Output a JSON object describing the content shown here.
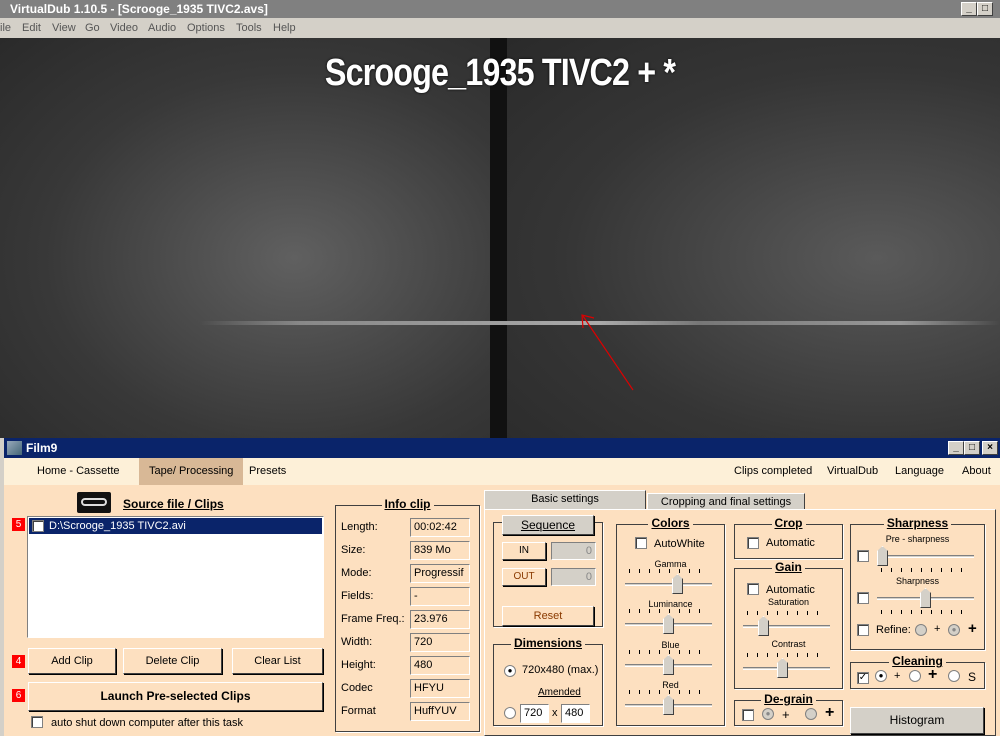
{
  "virtualdub": {
    "title": "VirtualDub 1.10.5 - [Scrooge_1935 TIVC2.avs]",
    "menu": [
      "ile",
      "Edit",
      "View",
      "Go",
      "Video",
      "Audio",
      "Options",
      "Tools",
      "Help"
    ],
    "overlay_text": "Scrooge_1935 TIVC2 +  *"
  },
  "film9": {
    "title": "Film9",
    "menu_left": [
      "Home - Cassette",
      "Tape/ Processing",
      "Presets"
    ],
    "menu_right": [
      "Clips completed",
      "VirtualDub",
      "Language",
      "About"
    ],
    "source": {
      "heading": "Source file / Clips",
      "clips": [
        {
          "name": "D:\\Scrooge_1935 TIVC2.avi",
          "checked": false
        }
      ],
      "badges": [
        "5",
        "4",
        "6"
      ],
      "add": "Add Clip",
      "delete": "Delete Clip",
      "clear": "Clear List",
      "launch": "Launch Pre-selected Clips",
      "shutdown": "auto shut down computer after this task"
    },
    "info": {
      "heading": "Info clip",
      "rows": [
        {
          "label": "Length:",
          "value": "00:02:42"
        },
        {
          "label": "Size:",
          "value": "839 Mo"
        },
        {
          "label": "Mode:",
          "value": "Progressif"
        },
        {
          "label": "Fields:",
          "value": "-"
        },
        {
          "label": "Frame Freq.:",
          "value": "23.976"
        },
        {
          "label": "Width:",
          "value": "720"
        },
        {
          "label": "Height:",
          "value": "480"
        },
        {
          "label": "Codec",
          "value": "HFYU"
        },
        {
          "label": "Format",
          "value": "HuffYUV"
        }
      ]
    },
    "tabs": [
      "Basic settings",
      "Cropping and final settings"
    ],
    "sequence": {
      "button": "Sequence",
      "in": "IN",
      "out": "OUT",
      "in_value": "0",
      "out_value": "0",
      "reset": "Reset"
    },
    "dimensions": {
      "heading": "Dimensions",
      "max": "720x480 (max.)",
      "amended": "Amended",
      "w": "720",
      "x": "x",
      "h": "480"
    },
    "colors": {
      "heading": "Colors",
      "autowhite": "AutoWhite",
      "gamma": "Gamma",
      "luminance": "Luminance",
      "blue": "Blue",
      "red": "Red",
      "levels": {
        "gamma": 0.62,
        "luminance": 0.5,
        "blue": 0.5,
        "red": 0.5
      }
    },
    "crop": {
      "heading": "Crop",
      "automatic": "Automatic"
    },
    "gain": {
      "heading": "Gain",
      "automatic": "Automatic",
      "saturation": "Saturation",
      "contrast": "Contrast",
      "levels": {
        "saturation": 0.2,
        "contrast": 0.45
      }
    },
    "degrain": {
      "heading": "De-grain",
      "plus": "+",
      "plus_bold": "+"
    },
    "sharpness": {
      "heading": "Sharpness",
      "pre": "Pre - sharpness",
      "sharp": "Sharpness",
      "refine": "Refine:",
      "plus": "+",
      "plus_bold": "+",
      "levels": {
        "pre": 0.0,
        "sharp": 0.5
      }
    },
    "cleaning": {
      "heading": "Cleaning",
      "plus": "+",
      "plus_bold": "+",
      "s": "S",
      "checked": true
    },
    "histogram": "Histogram"
  }
}
